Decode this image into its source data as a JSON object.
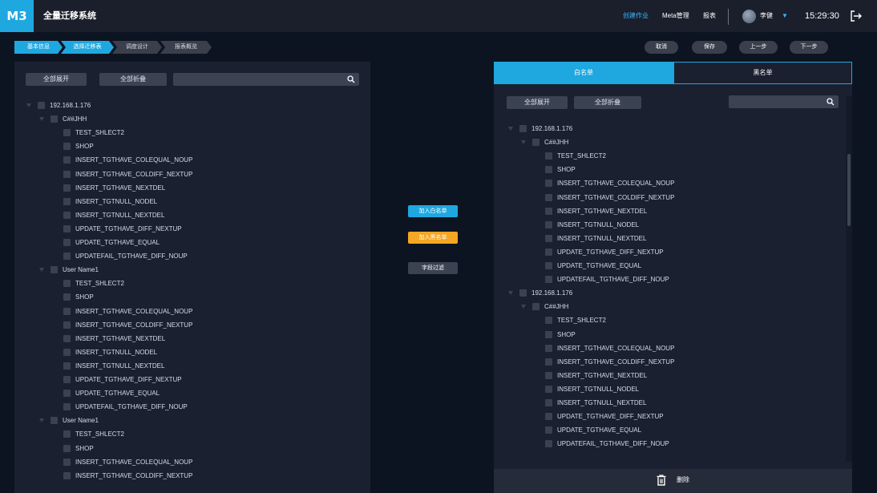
{
  "app": {
    "logo": "M3",
    "title": "全量迁移系统"
  },
  "topnav": {
    "create_job": "创建作业",
    "meta": "Meta管理",
    "report": "报表",
    "user": "李健",
    "time": "15:29:30"
  },
  "steps": [
    "基本信息",
    "选择迁移表",
    "调度设计",
    "报表概览"
  ],
  "actions": {
    "cancel": "取消",
    "save": "保存",
    "prev": "上一步",
    "next": "下一步"
  },
  "left": {
    "expand_all": "全部展开",
    "collapse_all": "全部折叠",
    "search_value": ""
  },
  "middle": {
    "add_white": "加入白名单",
    "add_black": "加入黑名单",
    "field_filter": "字段过滤"
  },
  "right": {
    "tab_white": "白名单",
    "tab_black": "黑名单",
    "expand_all": "全部展开",
    "collapse_all": "全部折叠",
    "search_value": "",
    "delete": "删除"
  },
  "tree": {
    "host": "192.168.1.176",
    "schema1": "C##JHH",
    "schema2": "User Name1",
    "tables": [
      "TEST_SHLECT2",
      "SHOP",
      "INSERT_TGTHAVE_COLEQUAL_NOUP",
      "INSERT_TGTHAVE_COLDIFF_NEXTUP",
      "INSERT_TGTHAVE_NEXTDEL",
      "INSERT_TGTNULL_NODEL",
      "INSERT_TGTNULL_NEXTDEL",
      "UPDATE_TGTHAVE_DIFF_NEXTUP",
      "UPDATE_TGTHAVE_EQUAL",
      "UPDATEFAIL_TGTHAVE_DIFF_NOUP"
    ]
  },
  "colors": {
    "accent": "#1fa8e0",
    "orange": "#f5a623",
    "bg": "#0d1421",
    "panel": "#1a2030"
  }
}
